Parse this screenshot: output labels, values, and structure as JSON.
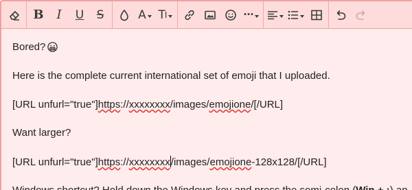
{
  "toolbar": {
    "groups": [
      [
        "clear-formatting-icon"
      ],
      [
        "bold-icon",
        "italic-icon",
        "underline-icon",
        "strikethrough-icon"
      ],
      [
        "text-color-icon",
        "font-family-icon",
        "font-size-icon"
      ],
      [
        "link-icon",
        "image-icon",
        "smilie-icon",
        "more-icon"
      ],
      [
        "align-icon",
        "list-icon",
        "table-icon"
      ],
      [
        "undo-icon",
        "redo-icon"
      ]
    ],
    "bold_glyph": "B",
    "italic_glyph": "I",
    "underline_glyph": "U",
    "strike_glyph": "S",
    "font_glyph": "A",
    "size_glyph": "T",
    "more_glyph": "···"
  },
  "content": {
    "line1_text": "Bored?",
    "line2": "Here is the complete current international set of emoji that I uploaded.",
    "line3": {
      "prefix": "[URL unfurl=\"true\"]",
      "a": "https",
      "b": "://",
      "c": "xxxxxxxx",
      "d": "/images/",
      "e": "emojione",
      "f": "/[/URL]"
    },
    "line4": "Want larger?",
    "line5": {
      "prefix": "[URL unfurl=\"true\"]",
      "a": "https",
      "b": "://",
      "c": "xxxxxxxx",
      "d": "/images/",
      "e": "emojione",
      "f": "-128x128/[/URL]"
    },
    "line6": {
      "a": "Windows shortcut?  Hold down the Windows key and press the semi-colon (",
      "b": "Win + ;",
      "c": ") an"
    }
  },
  "colors": {
    "background": "#ffecec",
    "toolbar": "#ffdcdc",
    "border": "#f0a0a0",
    "spellcheck": "#dd3333"
  }
}
